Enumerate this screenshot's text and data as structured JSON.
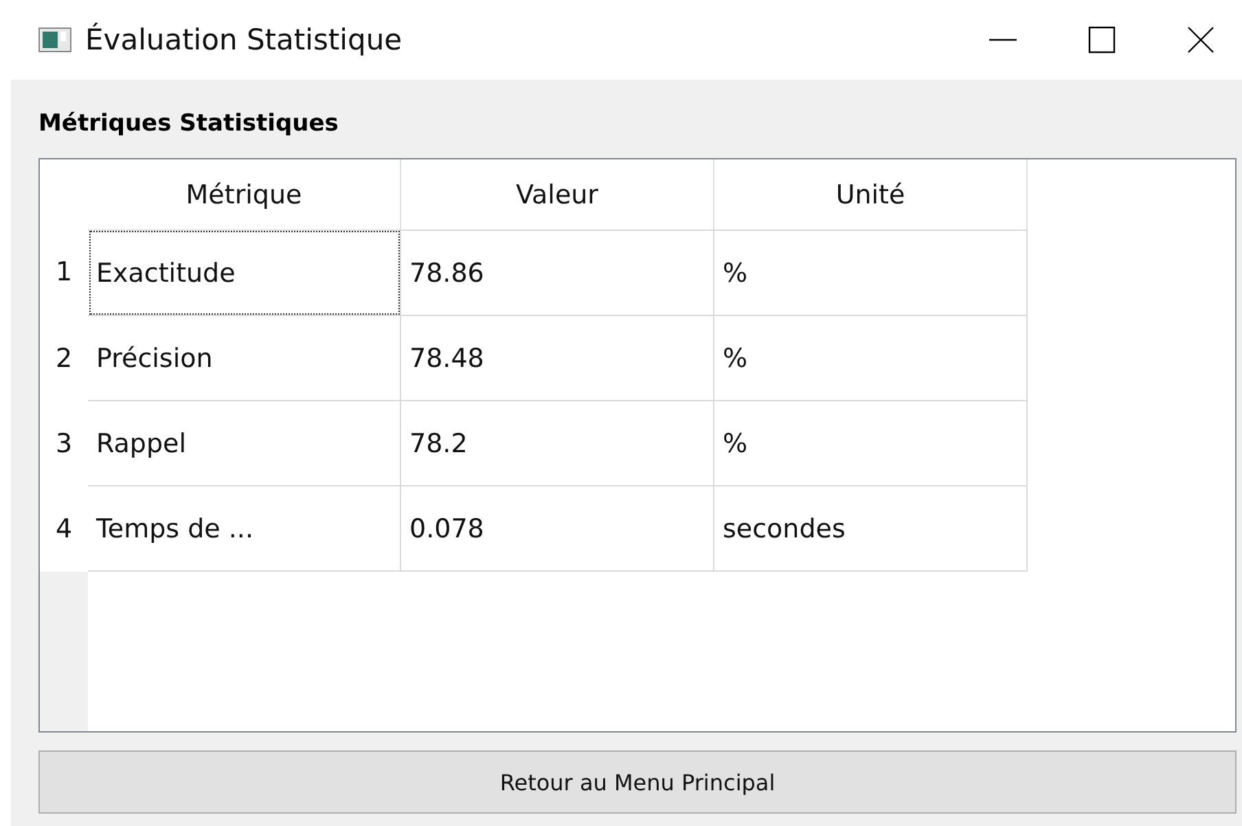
{
  "window": {
    "title": "Évaluation Statistique"
  },
  "group": {
    "title": "Métriques Statistiques"
  },
  "table": {
    "columns": [
      "Métrique",
      "Valeur",
      "Unité"
    ],
    "rows": [
      {
        "number": "1",
        "cells": [
          {
            "text": "Exactitude",
            "focused": true
          },
          {
            "text": "78.86",
            "focused": false
          },
          {
            "text": "%",
            "focused": false
          }
        ]
      },
      {
        "number": "2",
        "cells": [
          {
            "text": "Précision",
            "focused": false
          },
          {
            "text": "78.48",
            "focused": false
          },
          {
            "text": "%",
            "focused": false
          }
        ]
      },
      {
        "number": "3",
        "cells": [
          {
            "text": "Rappel",
            "focused": false
          },
          {
            "text": "78.2",
            "focused": false
          },
          {
            "text": "%",
            "focused": false
          }
        ]
      },
      {
        "number": "4",
        "cells": [
          {
            "text": "Temps de ...",
            "focused": false
          },
          {
            "text": "0.078",
            "focused": false
          },
          {
            "text": "secondes",
            "focused": false
          }
        ]
      }
    ]
  },
  "buttons": [
    "Retour au Menu Principal"
  ]
}
